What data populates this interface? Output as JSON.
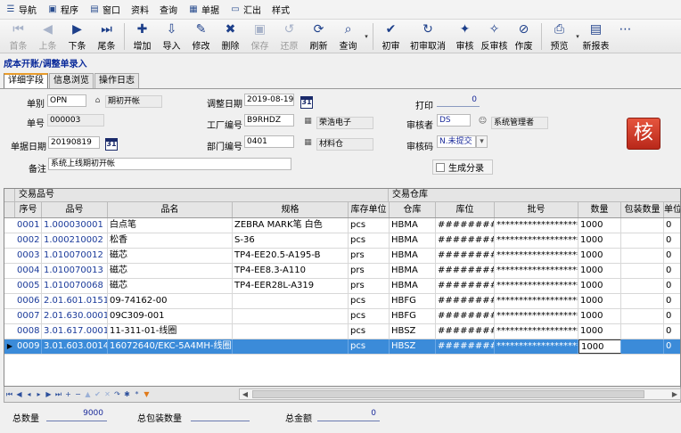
{
  "menu": [
    {
      "icon": "nav-icon",
      "glyph": "☰",
      "label": "导航"
    },
    {
      "icon": "program-icon",
      "glyph": "▣",
      "label": "程序"
    },
    {
      "icon": "window-icon",
      "glyph": "▤",
      "label": "窗口"
    },
    {
      "icon": "",
      "glyph": "",
      "label": "资料"
    },
    {
      "icon": "",
      "glyph": "",
      "label": "查询"
    },
    {
      "icon": "doc-icon",
      "glyph": "▦",
      "label": "单据"
    },
    {
      "icon": "folder-icon",
      "glyph": "▭",
      "label": "汇出"
    },
    {
      "icon": "",
      "glyph": "",
      "label": "样式"
    }
  ],
  "toolbar": [
    {
      "name": "first",
      "glyph": "⏮",
      "label": "首条",
      "disabled": true
    },
    {
      "name": "prev",
      "glyph": "◀",
      "label": "上条",
      "disabled": true
    },
    {
      "name": "next",
      "glyph": "▶",
      "label": "下条",
      "disabled": false
    },
    {
      "name": "last",
      "glyph": "⏭",
      "label": "尾条",
      "disabled": false
    },
    {
      "sep": true
    },
    {
      "name": "add",
      "glyph": "✚",
      "label": "增加",
      "disabled": false
    },
    {
      "name": "import",
      "glyph": "⇩",
      "label": "导入",
      "disabled": false
    },
    {
      "name": "edit",
      "glyph": "✎",
      "label": "修改",
      "disabled": false
    },
    {
      "name": "delete",
      "glyph": "✖",
      "label": "删除",
      "disabled": false
    },
    {
      "name": "save",
      "glyph": "▣",
      "label": "保存",
      "disabled": true
    },
    {
      "name": "restore",
      "glyph": "↺",
      "label": "还原",
      "disabled": true
    },
    {
      "name": "refresh",
      "glyph": "⟳",
      "label": "刷新",
      "disabled": false
    },
    {
      "name": "query",
      "glyph": "⌕",
      "label": "查询",
      "disabled": false
    },
    {
      "dd": true
    },
    {
      "sep": true
    },
    {
      "name": "first-audit",
      "glyph": "✔",
      "label": "初审",
      "disabled": false
    },
    {
      "name": "cancel-first-audit",
      "glyph": "↻",
      "label": "初审取消",
      "disabled": false,
      "wide": true
    },
    {
      "name": "audit",
      "glyph": "✦",
      "label": "审核",
      "disabled": false
    },
    {
      "name": "unaudit",
      "glyph": "✧",
      "label": "反审核",
      "disabled": false
    },
    {
      "name": "void",
      "glyph": "⊘",
      "label": "作废",
      "disabled": false
    },
    {
      "sep": true
    },
    {
      "name": "preview",
      "glyph": "⎙",
      "label": "预览",
      "disabled": false
    },
    {
      "dd": true
    },
    {
      "name": "new-report",
      "glyph": "▤",
      "label": "新报表",
      "disabled": false
    },
    {
      "name": "more",
      "glyph": "⋯",
      "label": "",
      "disabled": false
    }
  ],
  "form_title": "成本开账/调整单录入",
  "tabs": [
    "详细字段",
    "信息浏览",
    "操作日志"
  ],
  "fields": {
    "type_label": "单别",
    "type_value": "OPN",
    "type_name": "期初开帐",
    "no_label": "单号",
    "no_value": "000003",
    "date_label": "单据日期",
    "date_value": "20190819",
    "remark_label": "备注",
    "remark_value": "系统上线期初开帐",
    "adjust_date_label": "调整日期",
    "adjust_date_value": "2019-08-19",
    "factory_label": "工厂编号",
    "factory_value": "B9RHDZ",
    "factory_name": "荣浩电子",
    "dept_label": "部门编号",
    "dept_value": "0401",
    "dept_name": "材料仓",
    "print_label": "打印",
    "print_value": "0",
    "auditor_label": "审核者",
    "auditor_value": "DS",
    "auditor_name": "系统管理者",
    "audit_code_label": "审核码",
    "audit_code_value": "N.未提交",
    "gen_entry_label": "生成分录",
    "badge": "核"
  },
  "grid": {
    "groups": {
      "item": "交易品号",
      "warehouse": "交易仓库"
    },
    "columns": [
      "序号",
      "品号",
      "品名",
      "规格",
      "库存单位",
      "仓库",
      "库位",
      "批号",
      "数量",
      "包装数量",
      "单位"
    ],
    "rows": [
      [
        "0001",
        "1.000030001",
        "白点笔",
        "ZEBRA MARK笔 白色",
        "pcs",
        "HBMA",
        "##########",
        "********************",
        "1000",
        "",
        "0"
      ],
      [
        "0002",
        "1.000210002",
        "松香",
        "S-36",
        "pcs",
        "HBMA",
        "##########",
        "********************",
        "1000",
        "",
        "0"
      ],
      [
        "0003",
        "1.010070012",
        "磁芯",
        "TP4-EE20.5-A195-B",
        "prs",
        "HBMA",
        "##########",
        "********************",
        "1000",
        "",
        "0"
      ],
      [
        "0004",
        "1.010070013",
        "磁芯",
        "TP4-EE8.3-A110",
        "prs",
        "HBMA",
        "##########",
        "********************",
        "1000",
        "",
        "0"
      ],
      [
        "0005",
        "1.010070068",
        "磁芯",
        "TP4-EER28L-A319",
        "prs",
        "HBMA",
        "##########",
        "********************",
        "1000",
        "",
        "0"
      ],
      [
        "0006",
        "2.01.601.0151",
        "09-74162-00",
        "",
        "pcs",
        "HBFG",
        "##########",
        "********************",
        "1000",
        "",
        "0"
      ],
      [
        "0007",
        "2.01.630.0001",
        "09C309-001",
        "",
        "pcs",
        "HBFG",
        "##########",
        "********************",
        "1000",
        "",
        "0"
      ],
      [
        "0008",
        "3.01.617.0001",
        "11-311-01-线圈",
        "",
        "pcs",
        "HBSZ",
        "##########",
        "********************",
        "1000",
        "",
        "0"
      ],
      [
        "0009",
        "3.01.603.0014",
        "16072640/EKC-5A4MH-线圈",
        "",
        "pcs",
        "HBSZ",
        "##########",
        "********************",
        "1000",
        "",
        "0"
      ]
    ],
    "selected_row": 8
  },
  "nav_glyphs": [
    "⏮",
    "◀",
    "◂",
    "▸",
    "▶",
    "⏭",
    "+",
    "−",
    "▲",
    "✔",
    "✕",
    "↷",
    "✱",
    "*",
    "▼"
  ],
  "footer": {
    "total_qty_label": "总数量",
    "total_qty_value": "9000",
    "total_pack_label": "总包装数量",
    "total_pack_value": "",
    "total_amount_label": "总金额",
    "total_amount_value": "0"
  },
  "colors": {
    "accent": "#3b8bd9",
    "title": "#0a2a9a",
    "badge": "#c8361f"
  }
}
